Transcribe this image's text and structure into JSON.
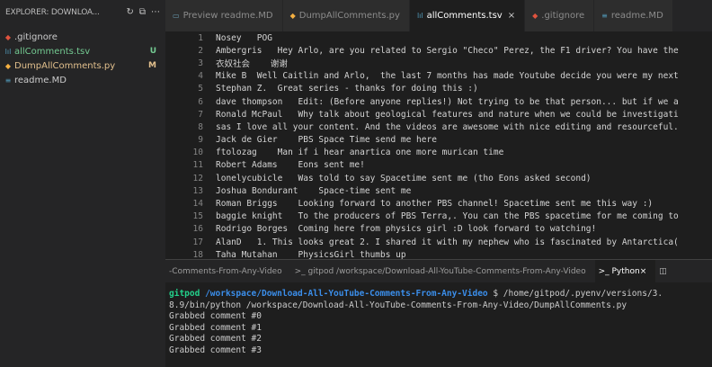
{
  "explorer": {
    "title": "EXPLORER: DOWNLOA...",
    "files": [
      {
        "name": ".gitignore",
        "icon": "◆",
        "icon_color": "#e0533e",
        "name_color": "#cccccc",
        "badge": ""
      },
      {
        "name": "allComments.tsv",
        "icon": "lıl",
        "icon_color": "#519aba",
        "name_color": "#73c991",
        "badge": "U",
        "badge_color": "#73c991"
      },
      {
        "name": "DumpAllComments.py",
        "icon": "◆",
        "icon_color": "#f5b041",
        "name_color": "#e2c08d",
        "badge": "M",
        "badge_color": "#e2c08d"
      },
      {
        "name": "readme.MD",
        "icon": "≡",
        "icon_color": "#519aba",
        "name_color": "#cccccc",
        "badge": ""
      }
    ]
  },
  "tabs": [
    {
      "label": "Preview readme.MD",
      "icon": "▭",
      "icon_color": "#6a9fb5",
      "active": false,
      "close": ""
    },
    {
      "label": "DumpAllComments.py",
      "icon": "◆",
      "icon_color": "#f5b041",
      "active": false,
      "close": ""
    },
    {
      "label": "allComments.tsv",
      "icon": "lıl",
      "icon_color": "#519aba",
      "active": true,
      "close": "×"
    },
    {
      "label": ".gitignore",
      "icon": "◆",
      "icon_color": "#e0533e",
      "active": false,
      "close": ""
    },
    {
      "label": "readme.MD",
      "icon": "≡",
      "icon_color": "#519aba",
      "active": false,
      "close": ""
    }
  ],
  "editor": {
    "lines": [
      {
        "n": "1",
        "text": "Nosey   POG"
      },
      {
        "n": "2",
        "text": "Ambergris   Hey Arlo, are you related to Sergio \"Checo\" Perez, the F1 driver? You have the"
      },
      {
        "n": "3",
        "text": "衣奴社会    谢谢"
      },
      {
        "n": "4",
        "text": "Mike B  Well Caitlin and Arlo,  the last 7 months has made Youtube decide you were my next"
      },
      {
        "n": "5",
        "text": "Stephan Z.  Great series - thanks for doing this :)"
      },
      {
        "n": "6",
        "text": "dave thompson   Edit: (Before anyone replies!) Not trying to be that person... but if we a"
      },
      {
        "n": "7",
        "text": "Ronald McPaul   Why talk about geological features and nature when we could be investigati"
      },
      {
        "n": "8",
        "text": "sas I love all your content. And the videos are awesome with nice editing and resourceful."
      },
      {
        "n": "9",
        "text": "Jack de Gier    PBS Space Time send me here"
      },
      {
        "n": "10",
        "text": "ftolozag    Man if i hear anartica one more murican time"
      },
      {
        "n": "11",
        "text": "Robert Adams    Eons sent me!"
      },
      {
        "n": "12",
        "text": "lonelycubicle   Was told to say Spacetime sent me (tho Eons asked second)"
      },
      {
        "n": "13",
        "text": "Joshua Bondurant    Space-time sent me"
      },
      {
        "n": "14",
        "text": "Roman Briggs    Looking forward to another PBS channel! Spacetime sent me this way :)"
      },
      {
        "n": "15",
        "text": "baggie knight   To the producers of PBS Terra,. You can the PBS spacetime for me coming to"
      },
      {
        "n": "16",
        "text": "Rodrigo Borges  Coming here from physics girl :D look forward to watching!"
      },
      {
        "n": "17",
        "text": "AlanD   1. This looks great 2. I shared it with my nephew who is fascinated by Antarctica("
      },
      {
        "n": "18",
        "text": "Taha Mutahan    PhysicsGirl thumbs up"
      }
    ]
  },
  "terminal": {
    "tabs": [
      {
        "label": "-Comments-From-Any-Video",
        "active": false
      },
      {
        "label": ">_ gitpod /workspace/Download-All-YouTube-Comments-From-Any-Video",
        "active": false
      },
      {
        "label": ">_ Python",
        "active": true,
        "close": "×"
      }
    ],
    "actions": "◫",
    "prompt_user": "gitpod",
    "prompt_path": "/workspace/Download-All-YouTube-Comments-From-Any-Video",
    "prompt_cmd": " $ /home/gitpod/.pyenv/versions/3.",
    "wrap_line": "8.9/bin/python /workspace/Download-All-YouTube-Comments-From-Any-Video/DumpAllComments.py",
    "output": [
      "Grabbed comment #0",
      "Grabbed comment #1",
      "Grabbed comment #2",
      "Grabbed comment #3"
    ]
  }
}
